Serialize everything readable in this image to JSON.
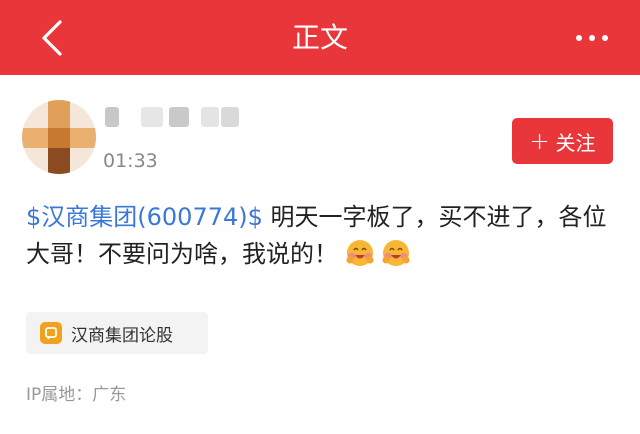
{
  "header": {
    "title": "正文",
    "back_icon": "chevron-left-icon",
    "more_icon": "more-dots-icon",
    "background": "#e8363a"
  },
  "post": {
    "time": "01:33",
    "follow_label": "关注",
    "follow_icon": "plus-icon",
    "stock_text": "$汉商集团(600774)$",
    "content": " 明天一字板了，买不进了，各位大哥！不要问为啥，我说的！",
    "emojis": [
      "smiling-face-icon",
      "smiling-face-icon"
    ],
    "forum_tag": "汉商集团论股",
    "ip_location": "IP属地：广东",
    "link_color": "#3a78d8",
    "accent_color": "#e8363a"
  }
}
